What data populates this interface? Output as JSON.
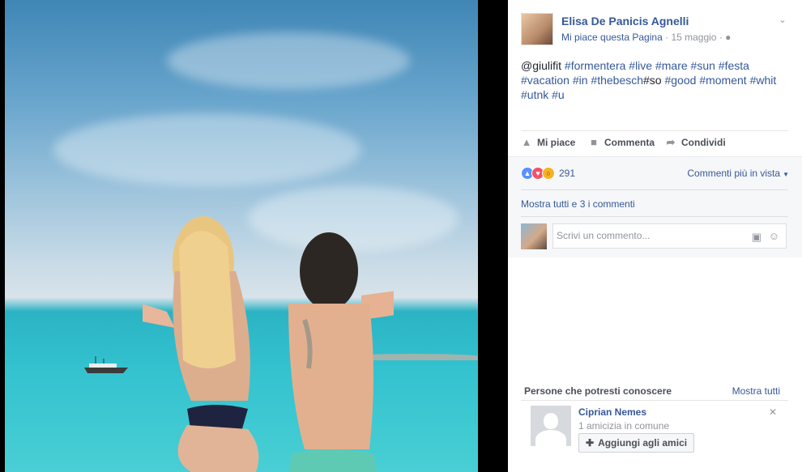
{
  "post": {
    "author": "Elisa De Panicis Agnelli",
    "like_page": "Mi piace questa Pagina",
    "separator": "·",
    "date": "15 maggio",
    "privacy_icon": "globe-icon",
    "text_parts": [
      {
        "text": "@giulifit ",
        "tag": false
      },
      {
        "text": "#formentera",
        "tag": true
      },
      {
        "text": " ",
        "tag": false
      },
      {
        "text": "#live",
        "tag": true
      },
      {
        "text": " ",
        "tag": false
      },
      {
        "text": "#mare",
        "tag": true
      },
      {
        "text": " ",
        "tag": false
      },
      {
        "text": "#sun",
        "tag": true
      },
      {
        "text": " ",
        "tag": false
      },
      {
        "text": "#festa",
        "tag": true
      },
      {
        "text": " ",
        "tag": false
      },
      {
        "text": "#vacation",
        "tag": true
      },
      {
        "text": " ",
        "tag": false
      },
      {
        "text": "#in",
        "tag": true
      },
      {
        "text": " ",
        "tag": false
      },
      {
        "text": "#thebesch",
        "tag": true
      },
      {
        "text": "#so",
        "tag": false
      },
      {
        "text": " ",
        "tag": false
      },
      {
        "text": "#good",
        "tag": true
      },
      {
        "text": " ",
        "tag": false
      },
      {
        "text": "#moment",
        "tag": true
      },
      {
        "text": " ",
        "tag": false
      },
      {
        "text": "#whit",
        "tag": true
      },
      {
        "text": " ",
        "tag": false
      },
      {
        "text": "#utnk",
        "tag": true
      },
      {
        "text": " ",
        "tag": false
      },
      {
        "text": "#u",
        "tag": true
      }
    ]
  },
  "actions": {
    "like": "Mi piace",
    "comment": "Commenta",
    "share": "Condividi"
  },
  "reactions": {
    "count": "291",
    "types": [
      "like",
      "love",
      "wow"
    ]
  },
  "comments": {
    "sort_label": "Commenti più in vista",
    "show_all": "Mostra tutti e 3 i commenti",
    "placeholder": "Scrivi un commento..."
  },
  "pymk": {
    "title": "Persone che potresti conoscere",
    "see_all": "Mostra tutti",
    "person": {
      "name": "Ciprian Nemes",
      "mutual": "1 amicizia in comune",
      "add_label": "Aggiungi agli amici"
    }
  },
  "colors": {
    "link": "#365899",
    "muted": "#90949c",
    "sea": "#33c2cf",
    "sky": "#6aa6cd"
  }
}
